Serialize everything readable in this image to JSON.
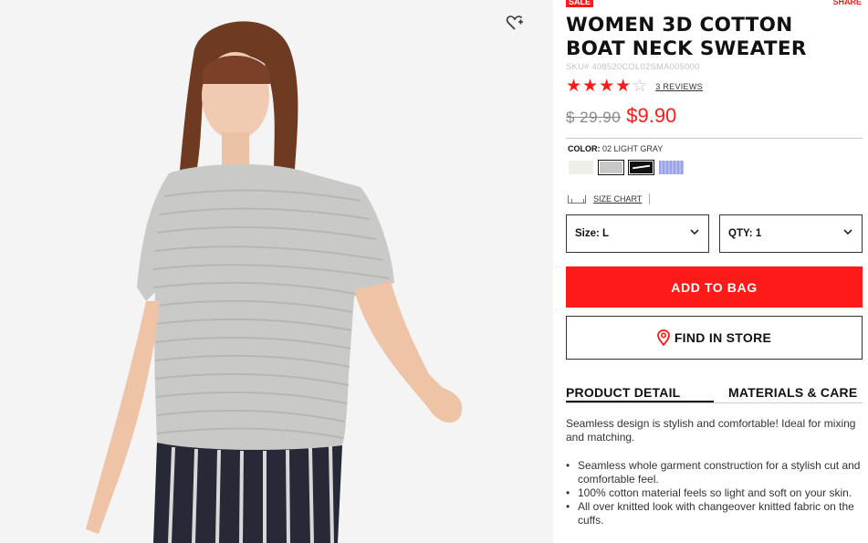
{
  "product": {
    "badge": "SALE",
    "share": "SHARE",
    "title": "WOMEN 3D COTTON BOAT NECK SWEATER",
    "sku": "SKU# 408520COL02SMA005000",
    "rating": 4,
    "rating_max": 5,
    "reviews": "3 REVIEWS",
    "old_price": "$ 29.90",
    "price": "$9.90"
  },
  "color": {
    "label": "COLOR:",
    "value": "02 LIGHT GRAY",
    "swatches": [
      {
        "name": "off-white",
        "hex": "#efefea"
      },
      {
        "name": "light-gray",
        "hex": "#c8c8c6"
      },
      {
        "name": "black-stripe",
        "hex": "#111111"
      },
      {
        "name": "lavender-blue",
        "hex": "#9aa2e6"
      }
    ],
    "selected_index": 1
  },
  "size_chart": "SIZE CHART",
  "size_select": {
    "label": "Size:",
    "value": "L"
  },
  "qty_select": {
    "label": "QTY:",
    "value": "1"
  },
  "buttons": {
    "add_to_bag": "ADD TO BAG",
    "find_in_store": "FIND IN STORE"
  },
  "tabs": [
    "PRODUCT DETAIL",
    "MATERIALS & CARE"
  ],
  "active_tab": 0,
  "description": "Seamless design is stylish and comfortable! Ideal for mixing and matching.",
  "features": [
    "Seamless whole garment construction for a stylish cut and comfortable feel.",
    "100% cotton material feels so light and soft on your skin.",
    "All over knitted look with changeover knitted fabric on the cuffs."
  ],
  "colors": {
    "accent": "#ff1a1a",
    "text": "#111111"
  }
}
